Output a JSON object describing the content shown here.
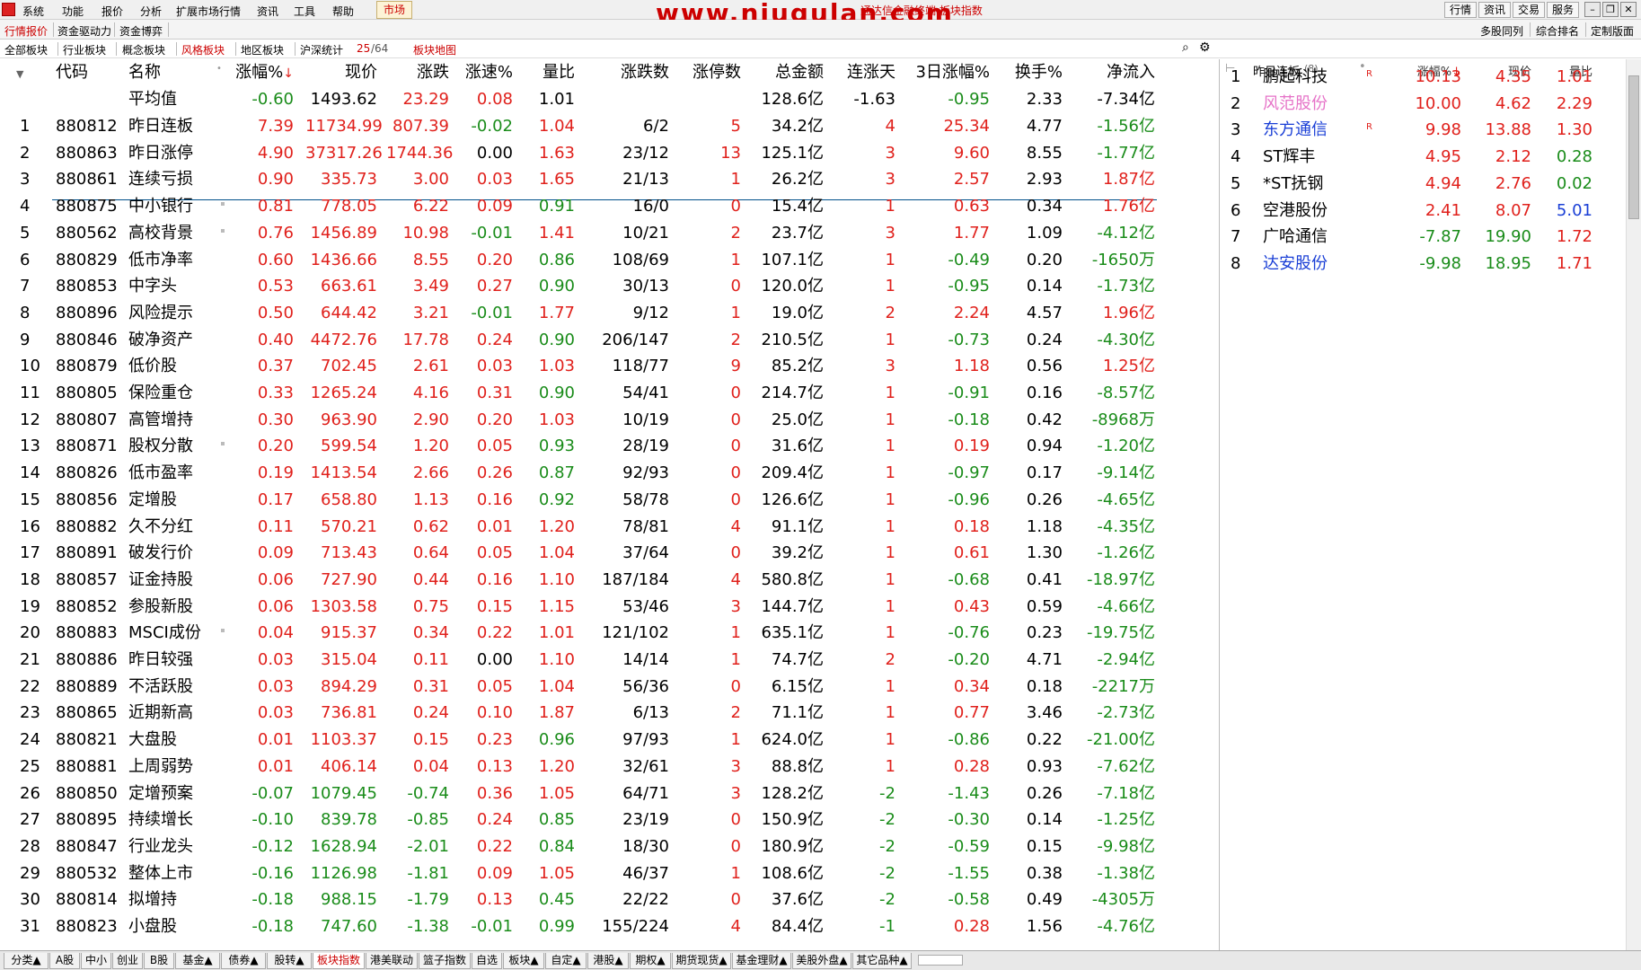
{
  "menubar": {
    "items": [
      "系统",
      "功能",
      "报价",
      "分析",
      "扩展市场行情",
      "资讯",
      "工具",
      "帮助"
    ],
    "market": "市场",
    "title": "通达信金融终端  板块指数",
    "watermark": "www.niugulan.com",
    "right_buttons": [
      "行情",
      "资讯",
      "交易",
      "服务"
    ]
  },
  "subtabs": {
    "items": [
      "行情报价",
      "资金驱动力",
      "资金博弈"
    ],
    "active": 0,
    "right_items": [
      "多股同列",
      "综合排名",
      "定制版面"
    ]
  },
  "boardtabs": {
    "items": [
      "全部板块",
      "行业板块",
      "概念板块",
      "风格板块",
      "地区板块",
      "沪深统计"
    ],
    "active": 3,
    "page_cur": "25",
    "page_total": "/64",
    "map": "板块地图"
  },
  "table": {
    "headers": {
      "code": "代码",
      "name": "名称",
      "chg": "涨幅%",
      "price": "现价",
      "delta": "涨跌",
      "speed": "涨速%",
      "vr": "量比",
      "updown": "涨跌数",
      "limitup": "涨停数",
      "amount": "总金额",
      "days": "连涨天",
      "chg3": "3日涨幅%",
      "turnover": "换手%",
      "netflow": "净流入"
    },
    "sort_arrow": "↓",
    "avg": {
      "name": "平均值",
      "chg": "-0.60",
      "price": "1493.62",
      "delta": "23.29",
      "speed": "0.08",
      "vr": "1.01",
      "amount": "128.6亿",
      "days": "-1.63",
      "chg3": "-0.95",
      "turnover": "2.33",
      "netflow": "-7.34亿"
    },
    "rows": [
      [
        "1",
        "880812",
        "昨日连板",
        "7.39",
        "11734.99",
        "807.39",
        "-0.02",
        "1.04",
        "6/2",
        "5",
        "34.2亿",
        "4",
        "25.34",
        "4.77",
        "-1.56亿"
      ],
      [
        "2",
        "880863",
        "昨日涨停",
        "4.90",
        "37317.26",
        "1744.36",
        "0.00",
        "1.63",
        "23/12",
        "13",
        "125.1亿",
        "3",
        "9.60",
        "8.55",
        "-1.77亿"
      ],
      [
        "3",
        "880861",
        "连续亏损",
        "0.90",
        "335.73",
        "3.00",
        "0.03",
        "1.65",
        "21/13",
        "1",
        "26.2亿",
        "3",
        "2.57",
        "2.93",
        "1.87亿"
      ],
      [
        "4",
        "880875",
        "中小银行",
        "0.81",
        "778.05",
        "6.22",
        "0.09",
        "0.91",
        "16/0",
        "0",
        "15.4亿",
        "1",
        "0.63",
        "0.34",
        "1.76亿"
      ],
      [
        "5",
        "880562",
        "高校背景",
        "0.76",
        "1456.89",
        "10.98",
        "-0.01",
        "1.41",
        "10/21",
        "2",
        "23.7亿",
        "3",
        "1.77",
        "1.09",
        "-4.12亿"
      ],
      [
        "6",
        "880829",
        "低市净率",
        "0.60",
        "1436.66",
        "8.55",
        "0.20",
        "0.86",
        "108/69",
        "1",
        "107.1亿",
        "1",
        "-0.49",
        "0.20",
        "-1650万"
      ],
      [
        "7",
        "880853",
        "中字头",
        "0.53",
        "663.61",
        "3.49",
        "0.27",
        "0.90",
        "30/13",
        "0",
        "120.0亿",
        "1",
        "-0.95",
        "0.14",
        "-1.73亿"
      ],
      [
        "8",
        "880896",
        "风险提示",
        "0.50",
        "644.42",
        "3.21",
        "-0.01",
        "1.77",
        "9/12",
        "1",
        "19.0亿",
        "2",
        "2.24",
        "4.57",
        "1.96亿"
      ],
      [
        "9",
        "880846",
        "破净资产",
        "0.40",
        "4472.76",
        "17.78",
        "0.24",
        "0.90",
        "206/147",
        "2",
        "210.5亿",
        "1",
        "-0.73",
        "0.24",
        "-4.30亿"
      ],
      [
        "10",
        "880879",
        "低价股",
        "0.37",
        "702.45",
        "2.61",
        "0.03",
        "1.03",
        "118/77",
        "9",
        "85.2亿",
        "3",
        "1.18",
        "0.56",
        "1.25亿"
      ],
      [
        "11",
        "880805",
        "保险重仓",
        "0.33",
        "1265.24",
        "4.16",
        "0.31",
        "0.90",
        "54/41",
        "0",
        "214.7亿",
        "1",
        "-0.91",
        "0.16",
        "-8.57亿"
      ],
      [
        "12",
        "880807",
        "高管增持",
        "0.30",
        "963.90",
        "2.90",
        "0.20",
        "1.03",
        "10/19",
        "0",
        "25.0亿",
        "1",
        "-0.18",
        "0.42",
        "-8968万"
      ],
      [
        "13",
        "880871",
        "股权分散",
        "0.20",
        "599.54",
        "1.20",
        "0.05",
        "0.93",
        "28/19",
        "0",
        "31.6亿",
        "1",
        "0.19",
        "0.94",
        "-1.20亿"
      ],
      [
        "14",
        "880826",
        "低市盈率",
        "0.19",
        "1413.54",
        "2.66",
        "0.26",
        "0.87",
        "92/93",
        "0",
        "209.4亿",
        "1",
        "-0.97",
        "0.17",
        "-9.14亿"
      ],
      [
        "15",
        "880856",
        "定增股",
        "0.17",
        "658.80",
        "1.13",
        "0.16",
        "0.92",
        "58/78",
        "0",
        "126.6亿",
        "1",
        "-0.96",
        "0.26",
        "-4.65亿"
      ],
      [
        "16",
        "880882",
        "久不分红",
        "0.11",
        "570.21",
        "0.62",
        "0.01",
        "1.20",
        "78/81",
        "4",
        "91.1亿",
        "1",
        "0.18",
        "1.18",
        "-4.35亿"
      ],
      [
        "17",
        "880891",
        "破发行价",
        "0.09",
        "713.43",
        "0.64",
        "0.05",
        "1.04",
        "37/64",
        "0",
        "39.2亿",
        "1",
        "0.61",
        "1.30",
        "-1.26亿"
      ],
      [
        "18",
        "880857",
        "证金持股",
        "0.06",
        "727.90",
        "0.44",
        "0.16",
        "1.10",
        "187/184",
        "4",
        "580.8亿",
        "1",
        "-0.68",
        "0.41",
        "-18.97亿"
      ],
      [
        "19",
        "880852",
        "参股新股",
        "0.06",
        "1303.58",
        "0.75",
        "0.15",
        "1.15",
        "53/46",
        "3",
        "144.7亿",
        "1",
        "0.43",
        "0.59",
        "-4.66亿"
      ],
      [
        "20",
        "880883",
        "MSCI成份",
        "0.04",
        "915.37",
        "0.34",
        "0.22",
        "1.01",
        "121/102",
        "1",
        "635.1亿",
        "1",
        "-0.76",
        "0.23",
        "-19.75亿"
      ],
      [
        "21",
        "880886",
        "昨日较强",
        "0.03",
        "315.04",
        "0.11",
        "0.00",
        "1.10",
        "14/14",
        "1",
        "74.7亿",
        "2",
        "-0.20",
        "4.71",
        "-2.94亿"
      ],
      [
        "22",
        "880889",
        "不活跃股",
        "0.03",
        "894.29",
        "0.31",
        "0.05",
        "1.04",
        "56/36",
        "0",
        "6.15亿",
        "1",
        "0.34",
        "0.18",
        "-2217万"
      ],
      [
        "23",
        "880865",
        "近期新高",
        "0.03",
        "736.81",
        "0.24",
        "0.10",
        "1.87",
        "6/13",
        "2",
        "71.1亿",
        "1",
        "0.77",
        "3.46",
        "-2.73亿"
      ],
      [
        "24",
        "880821",
        "大盘股",
        "0.01",
        "1103.37",
        "0.15",
        "0.23",
        "0.96",
        "97/93",
        "1",
        "624.0亿",
        "1",
        "-0.86",
        "0.22",
        "-21.00亿"
      ],
      [
        "25",
        "880881",
        "上周弱势",
        "0.01",
        "406.14",
        "0.04",
        "0.13",
        "1.20",
        "32/61",
        "3",
        "88.8亿",
        "1",
        "0.28",
        "0.93",
        "-7.62亿"
      ],
      [
        "26",
        "880850",
        "定增预案",
        "-0.07",
        "1079.45",
        "-0.74",
        "0.36",
        "1.05",
        "64/71",
        "3",
        "128.2亿",
        "-2",
        "-1.43",
        "0.26",
        "-7.18亿"
      ],
      [
        "27",
        "880895",
        "持续增长",
        "-0.10",
        "839.78",
        "-0.85",
        "0.24",
        "0.85",
        "23/19",
        "0",
        "150.9亿",
        "-2",
        "-0.30",
        "0.14",
        "-1.25亿"
      ],
      [
        "28",
        "880847",
        "行业龙头",
        "-0.12",
        "1628.94",
        "-2.01",
        "0.22",
        "0.84",
        "18/30",
        "0",
        "180.9亿",
        "-2",
        "-0.59",
        "0.15",
        "-9.98亿"
      ],
      [
        "29",
        "880532",
        "整体上市",
        "-0.16",
        "1126.98",
        "-1.81",
        "0.09",
        "1.05",
        "46/37",
        "1",
        "108.6亿",
        "-2",
        "-1.55",
        "0.38",
        "-1.38亿"
      ],
      [
        "30",
        "880814",
        "拟增持",
        "-0.18",
        "988.15",
        "-1.79",
        "0.13",
        "0.45",
        "22/22",
        "0",
        "37.6亿",
        "-2",
        "-0.58",
        "0.49",
        "-4305万"
      ],
      [
        "31",
        "880823",
        "小盘股",
        "-0.18",
        "747.60",
        "-1.38",
        "-0.01",
        "0.99",
        "155/224",
        "4",
        "84.4亿",
        "-1",
        "0.28",
        "1.56",
        "-4.76亿"
      ]
    ],
    "dot_rows": [
      3,
      4,
      12,
      19
    ]
  },
  "right_panel": {
    "title": "昨日连板",
    "count": "(8)",
    "headers": {
      "chg": "涨幅%",
      "price": "现价",
      "vr": "量比"
    },
    "sort_arrow": "↓",
    "rows": [
      {
        "idx": "1",
        "name": "鹏起科技",
        "mark": "R",
        "chg": "10.13",
        "price": "4.35",
        "vr": "1.01",
        "name_color": "#000000",
        "vr_color": "#e0211c"
      },
      {
        "idx": "2",
        "name": "风范股份",
        "mark": "",
        "chg": "10.00",
        "price": "4.62",
        "vr": "2.29",
        "name_color": "#e673c8",
        "vr_color": "#e0211c"
      },
      {
        "idx": "3",
        "name": "东方通信",
        "mark": "R",
        "chg": "9.98",
        "price": "13.88",
        "vr": "1.30",
        "name_color": "#1a3fd6",
        "vr_color": "#e0211c"
      },
      {
        "idx": "4",
        "name": "ST辉丰",
        "mark": "",
        "chg": "4.95",
        "price": "2.12",
        "vr": "0.28",
        "name_color": "#000000",
        "vr_color": "#1a8c1a"
      },
      {
        "idx": "5",
        "name": "*ST抚钢",
        "mark": "",
        "chg": "4.94",
        "price": "2.76",
        "vr": "0.02",
        "name_color": "#000000",
        "vr_color": "#1a8c1a"
      },
      {
        "idx": "6",
        "name": "空港股份",
        "mark": "",
        "chg": "2.41",
        "price": "8.07",
        "vr": "5.01",
        "name_color": "#000000",
        "vr_color": "#1a3fd6"
      },
      {
        "idx": "7",
        "name": "广哈通信",
        "mark": "",
        "chg": "-7.87",
        "price": "19.90",
        "vr": "1.72",
        "name_color": "#000000",
        "vr_color": "#e0211c"
      },
      {
        "idx": "8",
        "name": "达安股份",
        "mark": "",
        "chg": "-9.98",
        "price": "18.95",
        "vr": "1.71",
        "name_color": "#1a3fd6",
        "vr_color": "#e0211c"
      }
    ]
  },
  "bottom_tabs": [
    "分类▲",
    "A股",
    "中小",
    "创业",
    "B股",
    "基金▲",
    "债券▲",
    "股转▲",
    "板块指数",
    "港美联动",
    "篮子指数",
    "自选",
    "板块▲",
    "自定▲",
    "港股▲",
    "期权▲",
    "期货现货▲",
    "基金理财▲",
    "美股外盘▲",
    "其它品种▲"
  ],
  "bottom_active": 8,
  "colors": {
    "up": "#e0211c",
    "down": "#1a8c1a",
    "active_tab": "#cc0000"
  }
}
